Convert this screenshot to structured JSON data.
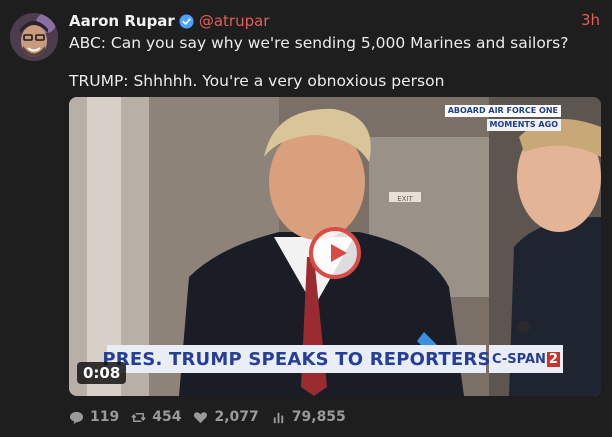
{
  "post": {
    "author": {
      "display_name": "Aaron Rupar",
      "handle": "@atrupar",
      "verified": true
    },
    "timestamp": "3h",
    "text_line_1": "ABC: Can you say why we're sending 5,000 Marines and sailors?",
    "text_line_2": "TRUMP: Shhhhh. You're a very obnoxious person",
    "media": {
      "type": "video",
      "duration": "0:08",
      "overlay_top_1": "ABOARD AIR FORCE ONE",
      "overlay_top_2": "MOMENTS AGO",
      "chyron": "PRES. TRUMP SPEAKS TO REPORTERS",
      "network_prefix": "C-SPAN",
      "network_suffix": "2",
      "sign": "EXIT"
    },
    "stats": {
      "replies": "119",
      "reposts": "454",
      "likes": "2,077",
      "views": "79,855"
    }
  },
  "colors": {
    "background": "#1e1e1e",
    "accent": "#e0605a",
    "muted": "#9a9a9a",
    "verified": "#4aa3ff"
  },
  "icons": [
    "reply-icon",
    "repost-icon",
    "like-icon",
    "views-icon",
    "verified-icon",
    "play-icon"
  ]
}
